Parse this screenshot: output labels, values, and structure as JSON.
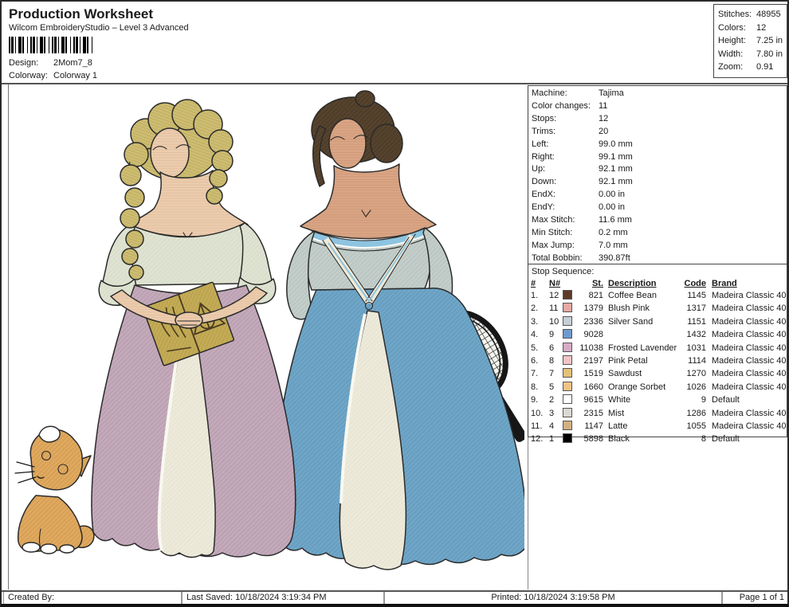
{
  "header": {
    "title": "Production Worksheet",
    "subtitle": "Wilcom EmbroideryStudio – Level 3 Advanced",
    "design_label": "Design:",
    "design_value": "2Mom7_8",
    "colorway_label": "Colorway:",
    "colorway_value": "Colorway 1",
    "stats": [
      {
        "label": "Stitches:",
        "value": "48955"
      },
      {
        "label": "Colors:",
        "value": "12"
      },
      {
        "label": "Height:",
        "value": "7.25 in"
      },
      {
        "label": "Width:",
        "value": "7.80 in"
      },
      {
        "label": "Zoom:",
        "value": "0.91"
      }
    ]
  },
  "machine_info": {
    "rows": [
      {
        "label": "Machine:",
        "value": "Tajima"
      },
      {
        "label": "Color changes:",
        "value": "11"
      },
      {
        "label": "Stops:",
        "value": "12"
      },
      {
        "label": "Trims:",
        "value": "20"
      },
      {
        "label": "Left:",
        "value": "99.0 mm"
      },
      {
        "label": "Right:",
        "value": "99.1 mm"
      },
      {
        "label": "Up:",
        "value": "92.1 mm"
      },
      {
        "label": "Down:",
        "value": "92.1 mm"
      },
      {
        "label": "EndX:",
        "value": "0.00 in"
      },
      {
        "label": "EndY:",
        "value": "0.00 in"
      },
      {
        "label": "Max Stitch:",
        "value": "11.6 mm"
      },
      {
        "label": "Min Stitch:",
        "value": "0.2 mm"
      },
      {
        "label": "Max Jump:",
        "value": "7.0 mm"
      },
      {
        "label": "Total Bobbin:",
        "value": "390.87ft"
      }
    ]
  },
  "stop_sequence": {
    "title": "Stop Sequence:",
    "columns": {
      "num": "#",
      "needle": "N#",
      "st": "St.",
      "description": "Description",
      "code": "Code",
      "brand": "Brand"
    },
    "rows": [
      {
        "num": "1.",
        "needle": "12",
        "color": "#5c3a2a",
        "st": "821",
        "description": "Coffee Bean",
        "code": "1145",
        "brand": "Madeira Classic 40"
      },
      {
        "num": "2.",
        "needle": "11",
        "color": "#e8a9a2",
        "st": "1379",
        "description": "Blush Pink",
        "code": "1317",
        "brand": "Madeira Classic 40"
      },
      {
        "num": "3.",
        "needle": "10",
        "color": "#c6cfd6",
        "st": "2336",
        "description": "Silver Sand",
        "code": "1151",
        "brand": "Madeira Classic 40"
      },
      {
        "num": "4.",
        "needle": "9",
        "color": "#6f9ad0",
        "st": "9028",
        "description": "",
        "code": "1432",
        "brand": "Madeira Classic 40"
      },
      {
        "num": "5.",
        "needle": "6",
        "color": "#d7aac6",
        "st": "11038",
        "description": "Frosted Lavender",
        "code": "1031",
        "brand": "Madeira Classic 40"
      },
      {
        "num": "6.",
        "needle": "8",
        "color": "#f3c3c6",
        "st": "2197",
        "description": "Pink Petal",
        "code": "1114",
        "brand": "Madeira Classic 40"
      },
      {
        "num": "7.",
        "needle": "7",
        "color": "#e3c178",
        "st": "1519",
        "description": "Sawdust",
        "code": "1270",
        "brand": "Madeira Classic 40"
      },
      {
        "num": "8.",
        "needle": "5",
        "color": "#f2c387",
        "st": "1660",
        "description": "Orange Sorbet",
        "code": "1026",
        "brand": "Madeira Classic 40"
      },
      {
        "num": "9.",
        "needle": "2",
        "color": "#ffffff",
        "st": "9615",
        "description": "White",
        "code": "9",
        "brand": "Default"
      },
      {
        "num": "10.",
        "needle": "3",
        "color": "#dadad2",
        "st": "2315",
        "description": "Mist",
        "code": "1286",
        "brand": "Madeira Classic 40"
      },
      {
        "num": "11.",
        "needle": "4",
        "color": "#d2b183",
        "st": "1147",
        "description": "Latte",
        "code": "1055",
        "brand": "Madeira Classic 40"
      },
      {
        "num": "12.",
        "needle": "1",
        "color": "#000000",
        "st": "5898",
        "description": "Black",
        "code": "8",
        "brand": "Default"
      }
    ]
  },
  "design_preview": {
    "description": "Embroidery preview: two women in 18th-century gowns, one holding a book, one with a tennis racket, and an orange cat",
    "colors": {
      "mauve_gown": "#c3aabb",
      "blue_gown": "#6fa6c8",
      "cream_underskirt": "#edeadb",
      "sage_bodice": "#dfe3d2",
      "gray_blue_bodice": "#c3cdc9",
      "trim_blue": "#8ec4e0",
      "skin_light": "#ebccae",
      "skin_tan": "#d9a584",
      "hair_blonde": "#cdbd72",
      "hair_brown": "#55432e",
      "cat_orange": "#dfa95f",
      "book_tan": "#c3ab57"
    }
  },
  "footer": {
    "created_by": "Created By:",
    "last_saved": "Last Saved: 10/18/2024 3:19:34 PM",
    "printed": "Printed: 10/18/2024 3:19:58 PM",
    "page": "Page 1 of 1"
  }
}
